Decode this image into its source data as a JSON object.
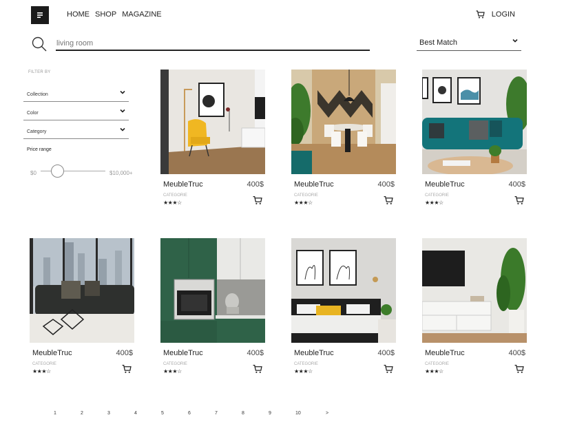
{
  "header": {
    "nav": [
      "HOME",
      "SHOP",
      "MAGAZINE"
    ],
    "login": "LOGIN"
  },
  "search": {
    "placeholder": "living room"
  },
  "sort": {
    "selected": "Best Match"
  },
  "filters": {
    "title": "FILTER BY",
    "rows": [
      "Collection",
      "Color",
      "Category"
    ],
    "price_title": "Price range",
    "price_min": "$0",
    "price_max": "$10,000+"
  },
  "products": [
    {
      "name": "MeubleTruc",
      "price": "400$",
      "category": "CATEGORIE",
      "stars": "★★★☆"
    },
    {
      "name": "MeubleTruc",
      "price": "400$",
      "category": "CATEGORIE",
      "stars": "★★★☆"
    },
    {
      "name": "MeubleTruc",
      "price": "400$",
      "category": "CATEGORIE",
      "stars": "★★★☆"
    },
    {
      "name": "MeubleTruc",
      "price": "400$",
      "category": "CATEGORIE",
      "stars": "★★★☆"
    },
    {
      "name": "MeubleTruc",
      "price": "400$",
      "category": "CATEGORIE",
      "stars": "★★★☆"
    },
    {
      "name": "MeubleTruc",
      "price": "400$",
      "category": "CATEGORIE",
      "stars": "★★★☆"
    },
    {
      "name": "MeubleTruc",
      "price": "400$",
      "category": "CATEGORIE",
      "stars": "★★★☆"
    }
  ],
  "pagination": [
    "1",
    "2",
    "3",
    "4",
    "5",
    "6",
    "7",
    "8",
    "9",
    "10",
    ">"
  ]
}
